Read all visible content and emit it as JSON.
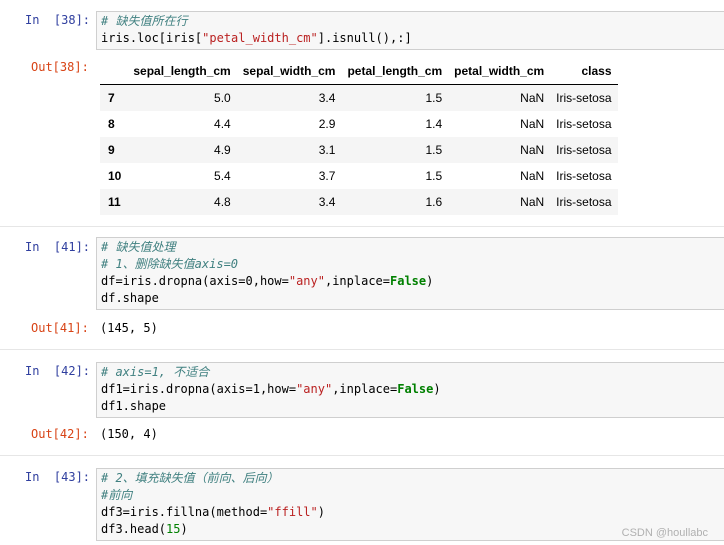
{
  "cells": [
    {
      "in_prompt": "In  [38]:",
      "code": [
        [
          {
            "t": "cm",
            "v": "# 缺失值所在行"
          }
        ],
        [
          {
            "t": "n",
            "v": "iris.loc[iris["
          },
          {
            "t": "st",
            "v": "\"petal_width_cm\""
          },
          {
            "t": "n",
            "v": "].isnull(),:]"
          }
        ]
      ],
      "out_prompt": "Out[38]:",
      "table": {
        "columns": [
          "",
          "sepal_length_cm",
          "sepal_width_cm",
          "petal_length_cm",
          "petal_width_cm",
          "class"
        ],
        "rows": [
          [
            "7",
            "5.0",
            "3.4",
            "1.5",
            "NaN",
            "Iris-setosa"
          ],
          [
            "8",
            "4.4",
            "2.9",
            "1.4",
            "NaN",
            "Iris-setosa"
          ],
          [
            "9",
            "4.9",
            "3.1",
            "1.5",
            "NaN",
            "Iris-setosa"
          ],
          [
            "10",
            "5.4",
            "3.7",
            "1.5",
            "NaN",
            "Iris-setosa"
          ],
          [
            "11",
            "4.8",
            "3.4",
            "1.6",
            "NaN",
            "Iris-setosa"
          ]
        ]
      }
    },
    {
      "in_prompt": "In  [41]:",
      "code": [
        [
          {
            "t": "cm",
            "v": "# 缺失值处理"
          }
        ],
        [
          {
            "t": "cm",
            "v": "# 1、删除缺失值axis=0"
          }
        ],
        [
          {
            "t": "n",
            "v": "df=iris.dropna(axis=0,how="
          },
          {
            "t": "st",
            "v": "\"any\""
          },
          {
            "t": "n",
            "v": ",inplace="
          },
          {
            "t": "kw",
            "v": "False"
          },
          {
            "t": "n",
            "v": ")"
          }
        ],
        [
          {
            "t": "n",
            "v": "df.shape"
          }
        ]
      ],
      "out_prompt": "Out[41]:",
      "output": "(145, 5)"
    },
    {
      "in_prompt": "In  [42]:",
      "code": [
        [
          {
            "t": "cm",
            "v": "# axis=1, 不适合"
          }
        ],
        [
          {
            "t": "n",
            "v": "df1=iris.dropna(axis=1,how="
          },
          {
            "t": "st",
            "v": "\"any\""
          },
          {
            "t": "n",
            "v": ",inplace="
          },
          {
            "t": "kw",
            "v": "False"
          },
          {
            "t": "n",
            "v": ")"
          }
        ],
        [
          {
            "t": "n",
            "v": "df1.shape"
          }
        ]
      ],
      "out_prompt": "Out[42]:",
      "output": "(150, 4)"
    },
    {
      "in_prompt": "In  [43]:",
      "code": [
        [
          {
            "t": "cm",
            "v": "# 2、填充缺失值（前向、后向）"
          }
        ],
        [
          {
            "t": "cm",
            "v": "#前向"
          }
        ],
        [
          {
            "t": "n",
            "v": "df3=iris.fillna(method="
          },
          {
            "t": "st",
            "v": "\"ffill\""
          },
          {
            "t": "n",
            "v": ")"
          }
        ],
        [
          {
            "t": "n",
            "v": "df3.head("
          },
          {
            "t": "nb",
            "v": "15"
          },
          {
            "t": "n",
            "v": ")"
          }
        ]
      ]
    }
  ],
  "watermark": "CSDN @houllabc"
}
